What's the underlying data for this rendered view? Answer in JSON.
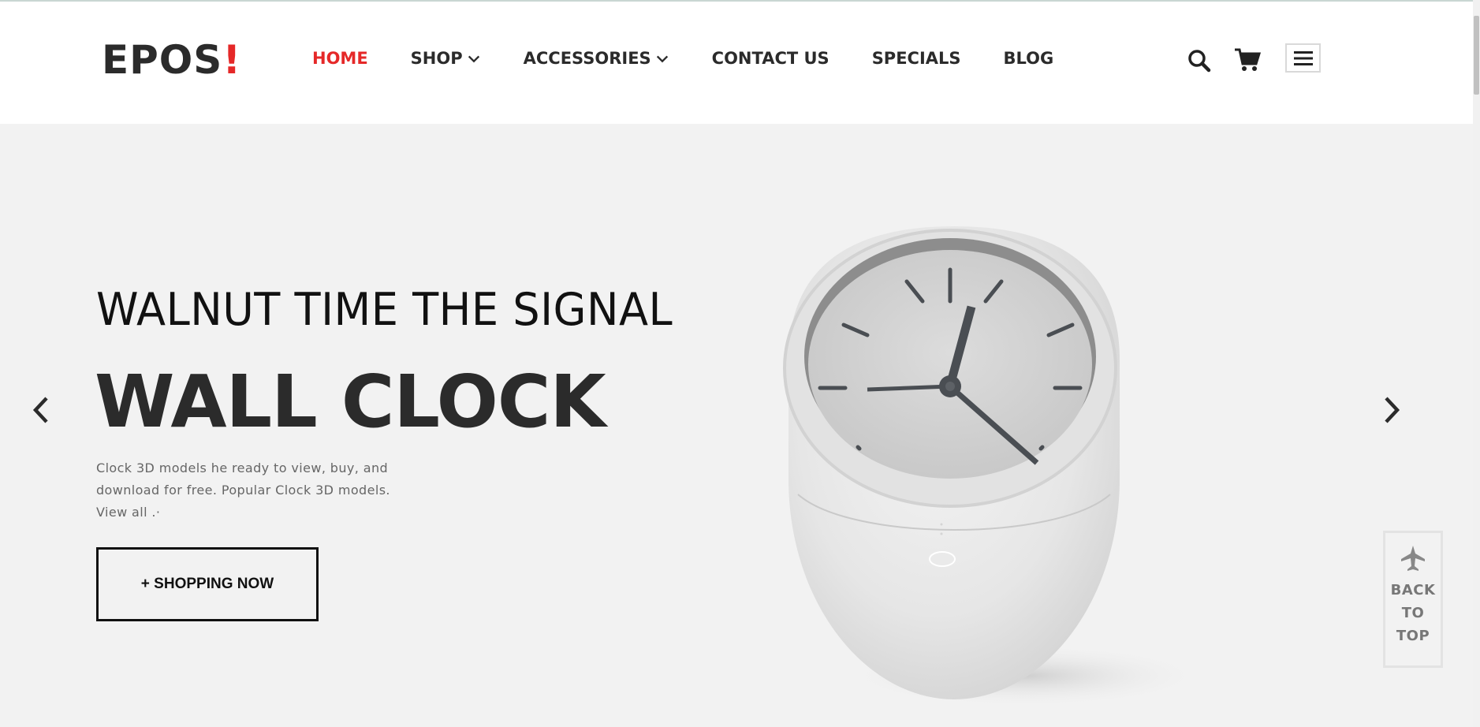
{
  "brand": {
    "logo_text": "EPOS",
    "logo_accent": "!",
    "accent_color": "#e52828"
  },
  "nav": {
    "items": [
      {
        "label": "HOME",
        "active": true
      },
      {
        "label": "SHOP",
        "has_dropdown": true
      },
      {
        "label": "ACCESSORIES",
        "has_dropdown": true
      },
      {
        "label": "CONTACT US"
      },
      {
        "label": "SPECIALS"
      },
      {
        "label": "BLOG"
      }
    ]
  },
  "header_icons": [
    "search-icon",
    "cart-icon",
    "hamburger-menu-icon"
  ],
  "hero": {
    "subtitle": "WALNUT TIME THE SIGNAL",
    "title": "WALL CLOCK",
    "description": "Clock 3D models he ready to view, buy, and download for free. Popular Clock 3D models. View all .·",
    "cta_label": "+ SHOPPING NOW",
    "prev_icon": "chevron-left-icon",
    "next_icon": "chevron-right-icon",
    "background_color": "#f2f2f2"
  },
  "back_to_top": {
    "icon": "airplane-icon",
    "line1": "BACK",
    "line2": "TO",
    "line3": "TOP"
  }
}
